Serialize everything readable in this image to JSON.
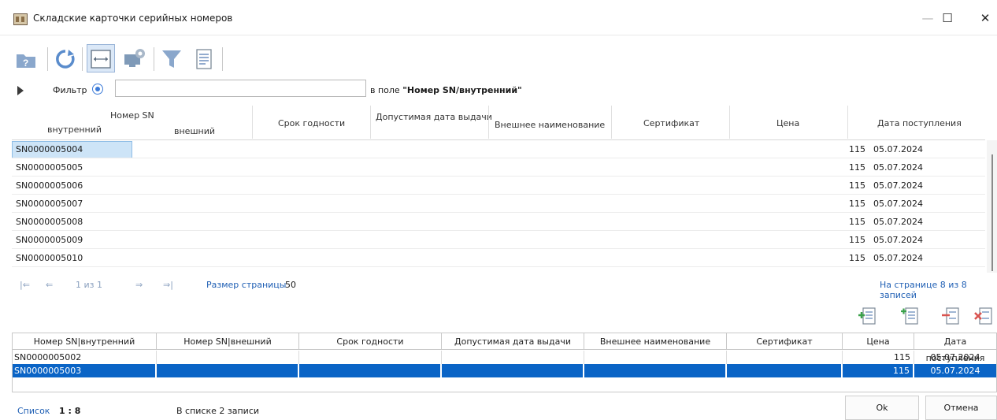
{
  "window": {
    "title": "Складские карточки серийных номеров",
    "minimize": "—",
    "maximize": "☐",
    "close": "✕"
  },
  "toolbar": {
    "icons": [
      "help-icon",
      "refresh-icon",
      "fit-columns-icon",
      "display-settings-icon",
      "filter-icon",
      "report-icon"
    ]
  },
  "filter": {
    "label": "Фильтр",
    "value": "",
    "in_field_prefix": "в поле ",
    "in_field_name": "\"Номер SN/внутренний\""
  },
  "grid": {
    "group_header": "Номер SN",
    "columns": [
      "внутренний",
      "внешний",
      "Срок годности",
      "Допустимая дата выдачи",
      "Внешнее наименование",
      "Сертификат",
      "Цена",
      "Дата поступления"
    ],
    "rows": [
      {
        "sn": "SN0000005004",
        "price": "115",
        "date": "05.07.2024"
      },
      {
        "sn": "SN0000005005",
        "price": "115",
        "date": "05.07.2024"
      },
      {
        "sn": "SN0000005006",
        "price": "115",
        "date": "05.07.2024"
      },
      {
        "sn": "SN0000005007",
        "price": "115",
        "date": "05.07.2024"
      },
      {
        "sn": "SN0000005008",
        "price": "115",
        "date": "05.07.2024"
      },
      {
        "sn": "SN0000005009",
        "price": "115",
        "date": "05.07.2024"
      },
      {
        "sn": "SN0000005010",
        "price": "115",
        "date": "05.07.2024"
      }
    ],
    "selected_row": 0
  },
  "pager": {
    "first": "|⇐",
    "prev": "⇐",
    "page_text": "1 из 1",
    "next": "⇒",
    "last": "⇒|",
    "size_label": "Размер страницы",
    "size_value": "50",
    "records_text": "На странице 8 из 8 записей"
  },
  "bottom_toolbar": {
    "icons": [
      "add-row-icon",
      "insert-row-icon",
      "remove-row-icon",
      "delete-all-icon"
    ]
  },
  "bottom_grid": {
    "columns": [
      "Номер SN|внутренний",
      "Номер SN|внешний",
      "Срок годности",
      "Допустимая дата выдачи",
      "Внешнее наименование",
      "Сертификат",
      "Цена",
      "Дата поступления"
    ],
    "rows": [
      {
        "sn": "SN0000005002",
        "price": "115",
        "date": "05.07.2024"
      },
      {
        "sn": "SN0000005003",
        "price": "115",
        "date": "05.07.2024"
      }
    ],
    "selected_row": 1
  },
  "status": {
    "list_label": "Список",
    "ratio": "1 : 8",
    "count_text": "В списке 2 записи"
  },
  "buttons": {
    "ok": "Ok",
    "cancel": "Отмена"
  },
  "colors": {
    "accent": "#0a64c6",
    "selection_light": "#cde4f7",
    "link": "#1f5fb4"
  }
}
